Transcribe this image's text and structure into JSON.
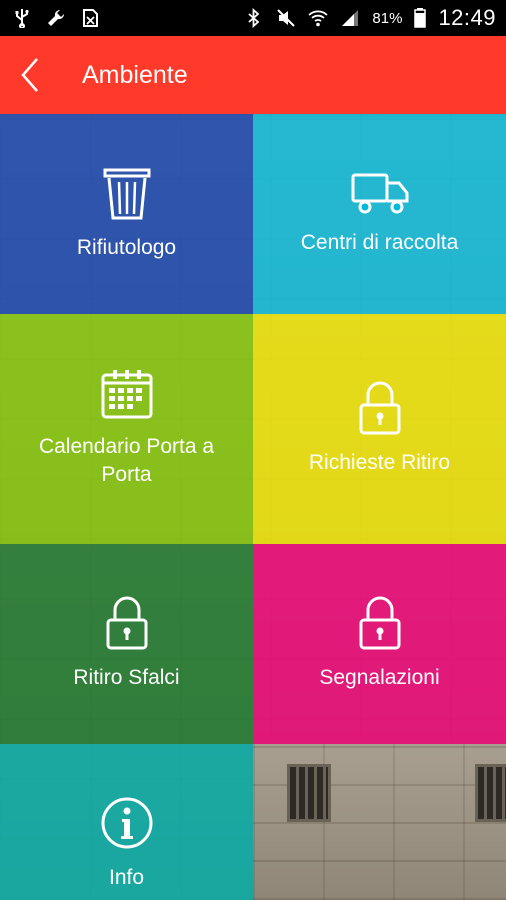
{
  "status_bar": {
    "icons_left": [
      "usb-icon",
      "wrench-icon",
      "sim-icon"
    ],
    "icons_right": [
      "bluetooth-icon",
      "mute-icon",
      "wifi-icon",
      "signal-icon"
    ],
    "battery": "81%",
    "time": "12:49"
  },
  "app_bar": {
    "title": "Ambiente",
    "color": "#ff3a2a",
    "back_icon": "chevron-left-icon"
  },
  "tiles": [
    {
      "label": "Rifiutologo",
      "icon": "trash-icon",
      "color": "#1946af"
    },
    {
      "label": "Centri di raccolta",
      "icon": "truck-icon",
      "color": "#00badc"
    },
    {
      "label": "Calendario Porta a Porta",
      "icon": "calendar-icon",
      "color": "#82c800"
    },
    {
      "label": "Richieste Ritiro",
      "icon": "lock-icon",
      "color": "#f0e600"
    },
    {
      "label": "Ritiro Sfalci",
      "icon": "lock-icon",
      "color": "#147828"
    },
    {
      "label": "Segnalazioni",
      "icon": "lock-icon",
      "color": "#f00078"
    },
    {
      "label": "Info",
      "icon": "info-icon",
      "color": "#00afaa"
    }
  ]
}
